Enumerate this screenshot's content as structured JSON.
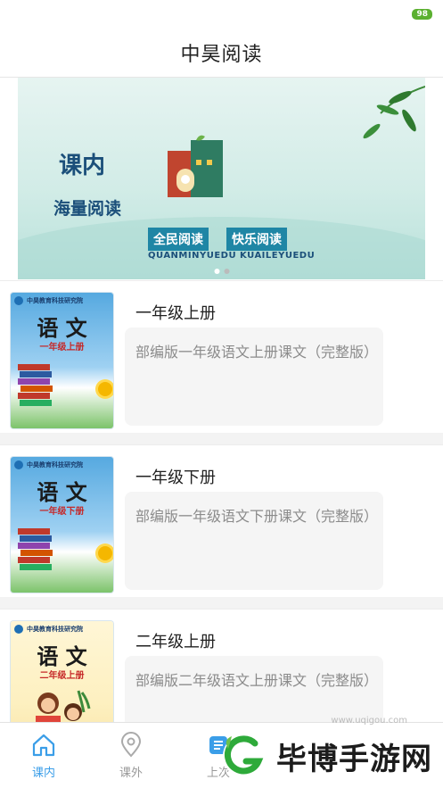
{
  "status": {
    "battery": "98"
  },
  "header": {
    "title": "中昊阅读"
  },
  "banner": {
    "heading_main": "课内",
    "heading_sub": "海量阅读",
    "tag_left": "全民阅读",
    "tag_right": "快乐阅读",
    "pinyin": "QUANMINYUEDU KUAILEYUEDU",
    "page_count": 2,
    "active_page": 1
  },
  "books": [
    {
      "title": "一年级上册",
      "description": "部编版一年级语文上册课文（完整版）",
      "cover_subject": "语 文",
      "cover_grade": "一年级上册",
      "cover_org": "中昊教育科技研究院"
    },
    {
      "title": "一年级下册",
      "description": "部编版一年级语文下册课文（完整版）",
      "cover_subject": "语 文",
      "cover_grade": "一年级下册",
      "cover_org": "中昊教育科技研究院"
    },
    {
      "title": "二年级上册",
      "description": "部编版二年级语文上册课文（完整版）",
      "cover_subject": "语 文",
      "cover_grade": "二年级上册",
      "cover_org": "中昊教育科技研究院"
    }
  ],
  "tabs": [
    {
      "label": "课内",
      "icon": "home-icon",
      "active": true
    },
    {
      "label": "课外",
      "icon": "location-pin-icon",
      "active": false
    },
    {
      "label": "上次",
      "icon": "history-icon",
      "active": false
    }
  ],
  "watermark": {
    "text": "毕博手游网",
    "url": "www.uqigou.com"
  },
  "colors": {
    "accent": "#3b9ee8",
    "banner_tag": "#1f86a5",
    "grade_red": "#c62828"
  }
}
